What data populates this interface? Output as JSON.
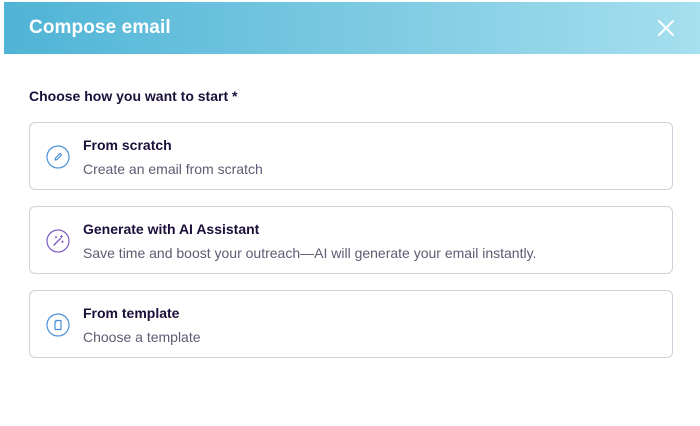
{
  "dialog": {
    "title": "Compose email",
    "close_icon": "close-icon"
  },
  "prompt": "Choose how you want to start *",
  "options": [
    {
      "title": "From scratch",
      "description": "Create an email from scratch",
      "icon": "pencil-icon",
      "color": "#4a90d9"
    },
    {
      "title": "Generate with AI Assistant",
      "description": "Save time and boost your outreach—AI will generate your email instantly.",
      "icon": "magic-wand-icon",
      "color": "#7b5cc4"
    },
    {
      "title": "From template",
      "description": "Choose a template",
      "icon": "template-icon",
      "color": "#4a90d9"
    }
  ]
}
